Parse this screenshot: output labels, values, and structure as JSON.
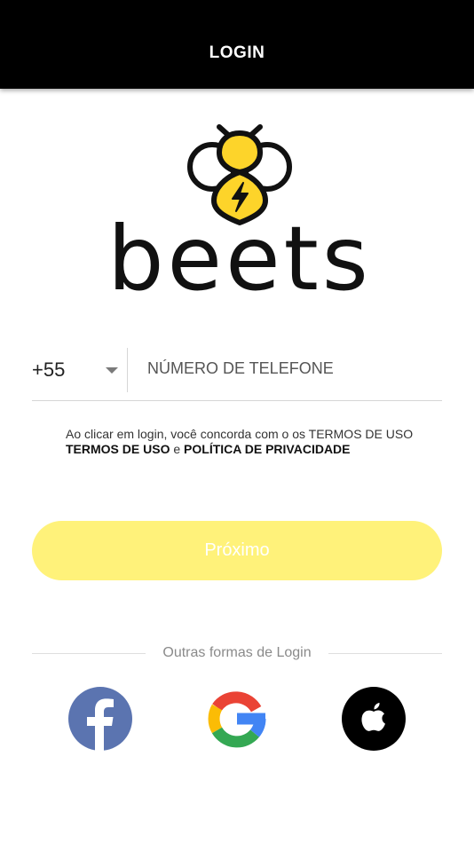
{
  "header": {
    "title": "LOGIN"
  },
  "logo": {
    "wordmark": "beets",
    "accent_color": "#fdd42a"
  },
  "phone": {
    "country_code": "+55",
    "placeholder": "NÚMERO DE TELEFONE",
    "value": ""
  },
  "terms": {
    "line1": "Ao clicar em login, você concorda com o os TERMOS DE USO",
    "terms_link": "TERMOS DE USO",
    "conjunction": "e",
    "privacy_link": "POLÍTICA DE PRIVACIDADE"
  },
  "next_button": {
    "label": "Próximo",
    "bg_color": "#fff27a"
  },
  "other_logins": {
    "label": "Outras formas de Login",
    "providers": [
      {
        "name": "facebook",
        "icon": "facebook-icon",
        "color": "#5b74b0"
      },
      {
        "name": "google",
        "icon": "google-icon"
      },
      {
        "name": "apple",
        "icon": "apple-icon",
        "color": "#000000"
      }
    ]
  }
}
